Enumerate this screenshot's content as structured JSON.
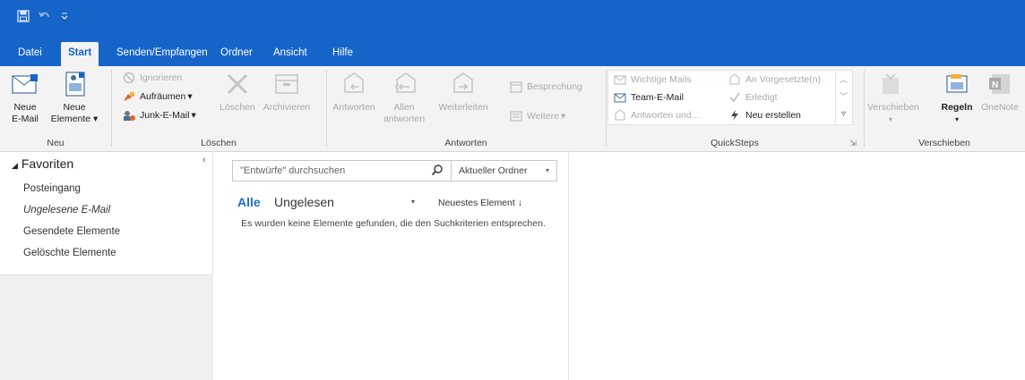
{
  "colors": {
    "accent": "#1664c8",
    "ribbon_bg": "#f3f3f3",
    "link_blue": "#1e6cc8",
    "disabled": "#a8a8a8"
  },
  "quick_access": [
    {
      "name": "save-icon"
    },
    {
      "name": "undo-icon"
    },
    {
      "name": "customize-chevron-icon"
    }
  ],
  "tabs": [
    "Datei",
    "Start",
    "Senden/Empfangen",
    "Ordner",
    "Ansicht",
    "Hilfe"
  ],
  "ribbon": {
    "neu": {
      "label": "Neu",
      "new_email": "Neue\nE-Mail",
      "new_items": "Neue\nElemente"
    },
    "loeschen": {
      "label": "Löschen",
      "ignorieren": "Ignorieren",
      "aufraeumen": "Aufräumen",
      "junk": "Junk-E-Mail",
      "loeschen_btn": "Löschen",
      "archivieren": "Archivieren"
    },
    "antworten": {
      "label": "Antworten",
      "antworten_btn": "Antworten",
      "allen_antworten": "Allen\nantworten",
      "weiterleiten": "Weiterleiten",
      "besprechung": "Besprechung",
      "weitere": "Weitere"
    },
    "quicksteps": {
      "label": "QuickSteps",
      "wichtige_mails": "Wichtige Mails",
      "team_email": "Team-E-Mail",
      "antworten_und": "Antworten und...",
      "an_vorgesetzte": "An Vorgesetzte(n)",
      "erledigt": "Erledigt",
      "neu_erstellen": "Neu erstellen"
    },
    "verschieben": {
      "label": "Verschieben",
      "verschieben_btn": "Verschieben",
      "regeln": "Regeln",
      "onenote": "OneNote"
    }
  },
  "nav": {
    "favorites_header": "Favoriten",
    "items": [
      "Posteingang",
      "Ungelesene E-Mail",
      "Gesendete Elemente",
      "Gelöschte Elemente"
    ]
  },
  "list": {
    "search_placeholder": "\"Entwürfe\" durchsuchen",
    "scope": "Aktueller Ordner",
    "filter_all": "Alle",
    "filter_unread": "Ungelesen",
    "sort": "Neuestes Element",
    "empty_message": "Es wurden keine Elemente gefunden, die den Suchkriterien entsprechen."
  }
}
